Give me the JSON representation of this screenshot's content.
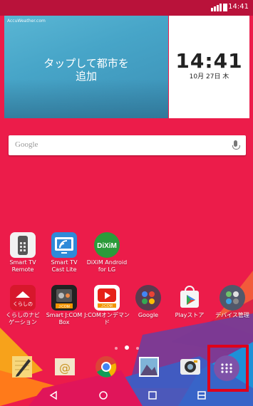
{
  "status_bar": {
    "time": "14:41"
  },
  "widget": {
    "weather_brand": "AccuWeather.com",
    "weather_line1": "タップして都市を",
    "weather_line2": "追加",
    "clock_time": "14:41",
    "clock_date": "10月 27日 木"
  },
  "search": {
    "label": "Google"
  },
  "apps_row1": [
    {
      "label1": "Smart TV",
      "label2": "Remote"
    },
    {
      "label1": "Smart TV",
      "label2": "Cast Lite"
    },
    {
      "label1": "DiXiM Android",
      "label2": "for LG",
      "icon_text": "DiXiM"
    }
  ],
  "apps_row2": [
    {
      "label1": "くらしのナビ",
      "label2": "ゲーション",
      "icon_text": "くらしの"
    },
    {
      "label1": "Smart J:COM",
      "label2": "Box",
      "icon_text": "J:COM"
    },
    {
      "label1": "J:COMオンデマン",
      "label2": "ド",
      "icon_text": "J:COM"
    },
    {
      "label1": "Google",
      "label2": ""
    },
    {
      "label1": "Playストア",
      "label2": ""
    },
    {
      "label1": "デバイス管理",
      "label2": ""
    }
  ],
  "dock": [
    "memo-icon",
    "email-icon",
    "chrome-icon",
    "gallery-icon",
    "camera-icon",
    "apps-icon"
  ],
  "page_indicator": {
    "pages": 3,
    "current": 1
  },
  "colors": {
    "wallpaper": "#ec1c4a",
    "highlight": "#e0001a",
    "apps_button": "#7e52a8"
  }
}
